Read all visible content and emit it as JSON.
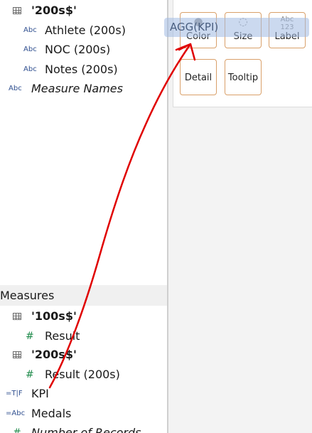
{
  "data_pane": {
    "dimensions": [
      {
        "label": "'200s$'",
        "icon": "table-icon",
        "kind": "table"
      },
      {
        "label": "Athlete (200s)",
        "icon_text": "Abc",
        "kind": "field"
      },
      {
        "label": "NOC (200s)",
        "icon_text": "Abc",
        "kind": "field"
      },
      {
        "label": "Notes (200s)",
        "icon_text": "Abc",
        "kind": "field"
      },
      {
        "label": "Measure Names",
        "icon_text": "Abc",
        "kind": "special"
      }
    ],
    "measures_header": "Measures",
    "measures": [
      {
        "label": "'100s$'",
        "icon": "table-icon",
        "kind": "table"
      },
      {
        "label": "Result",
        "icon_text": "#",
        "kind": "field"
      },
      {
        "label": "'200s$'",
        "icon": "table-icon",
        "kind": "table"
      },
      {
        "label": "Result (200s)",
        "icon_text": "#",
        "kind": "field"
      },
      {
        "label": "KPI",
        "icon_text": "=T|F",
        "kind": "calc"
      },
      {
        "label": "Medals",
        "icon_text": "=Abc",
        "kind": "calc"
      },
      {
        "label": "Number of Records",
        "icon_text": "#",
        "kind": "special"
      }
    ]
  },
  "marks_card": {
    "buttons": [
      {
        "label": "Color",
        "glyph": "●",
        "icon": "color-icon"
      },
      {
        "label": "Size",
        "glyph": "◌",
        "icon": "size-icon"
      },
      {
        "label": "Label",
        "glyph": "Abc\n123",
        "icon": "label-icon"
      },
      {
        "label": "Detail",
        "glyph": "",
        "icon": "detail-icon"
      },
      {
        "label": "Tooltip",
        "glyph": "",
        "icon": "tooltip-icon"
      }
    ]
  },
  "drag_pill": {
    "label": "AGG(KPI)"
  },
  "colors": {
    "arrow": "#e00000",
    "mark_border": "#d9a06a",
    "shelf_bg": "#f3f3f3",
    "measures_header_bg": "#f0f0f0"
  }
}
